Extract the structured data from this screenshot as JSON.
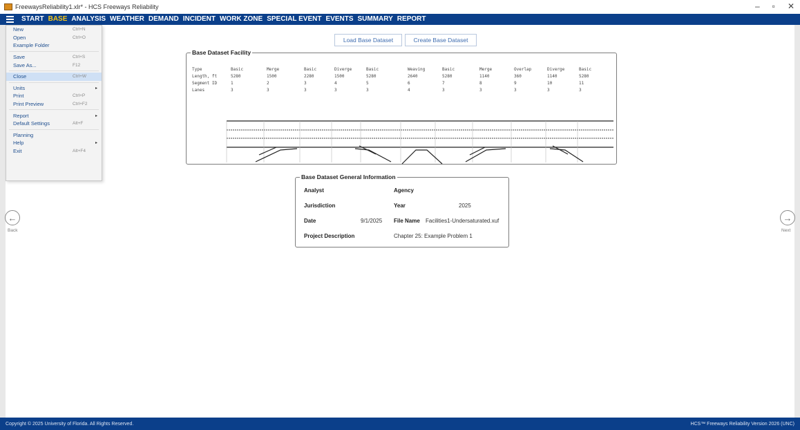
{
  "window": {
    "title": "FreewaysReliability1.xlr* - HCS Freeways Reliability",
    "controls": [
      "–",
      "▫",
      "✕"
    ]
  },
  "menu": {
    "tabs": [
      {
        "label": "START",
        "active": false
      },
      {
        "label": "BASE",
        "active": true
      },
      {
        "label": "ANALYSIS",
        "active": false
      },
      {
        "label": "WEATHER",
        "active": false
      },
      {
        "label": "DEMAND",
        "active": false
      },
      {
        "label": "INCIDENT",
        "active": false
      },
      {
        "label": "WORK ZONE",
        "active": false
      },
      {
        "label": "SPECIAL EVENT",
        "active": false
      },
      {
        "label": "EVENTS",
        "active": false
      },
      {
        "label": "SUMMARY",
        "active": false
      },
      {
        "label": "REPORT",
        "active": false
      }
    ],
    "active_color": "#f5c518",
    "bar_color": "#0b3f8a"
  },
  "file_menu": {
    "items": [
      {
        "label": "New",
        "shortcut": "Ctrl+N"
      },
      {
        "label": "Open",
        "shortcut": "Ctrl+O"
      },
      {
        "label": "Example Folder",
        "shortcut": ""
      },
      {
        "label": "Save",
        "shortcut": "Ctrl+S"
      },
      {
        "label": "Save As...",
        "shortcut": "F12"
      },
      {
        "label": "Close",
        "shortcut": "Ctrl+W"
      },
      {
        "label": "Units",
        "shortcut": "",
        "submenu": true
      },
      {
        "label": "Print",
        "shortcut": "Ctrl+P"
      },
      {
        "label": "Print Preview",
        "shortcut": "Ctrl+F2"
      },
      {
        "label": "Report",
        "shortcut": "",
        "submenu": true
      },
      {
        "label": "Default Settings",
        "shortcut": "Alt+F"
      },
      {
        "label": "Planning",
        "shortcut": ""
      },
      {
        "label": "Help",
        "shortcut": "",
        "submenu": true
      },
      {
        "label": "Exit",
        "shortcut": "Alt+F4"
      }
    ],
    "highlighted": "Close"
  },
  "buttons": {
    "load_base": "Load Base Dataset",
    "create_base": "Create Base Dataset"
  },
  "facility": {
    "title": "Base Dataset Facility",
    "row_labels": [
      "Type",
      "Length, ft",
      "Segment ID",
      "Lanes"
    ],
    "segments": [
      {
        "type": "Basic",
        "length": "5280",
        "id": "1",
        "lanes": "3"
      },
      {
        "type": "Merge",
        "length": "1500",
        "id": "2",
        "lanes": "3"
      },
      {
        "type": "Basic",
        "length": "2280",
        "id": "3",
        "lanes": "3"
      },
      {
        "type": "Diverge",
        "length": "1500",
        "id": "4",
        "lanes": "3"
      },
      {
        "type": "Basic",
        "length": "5280",
        "id": "5",
        "lanes": "3"
      },
      {
        "type": "Weaving",
        "length": "2640",
        "id": "6",
        "lanes": "4"
      },
      {
        "type": "Basic",
        "length": "5280",
        "id": "7",
        "lanes": "3"
      },
      {
        "type": "Merge",
        "length": "1140",
        "id": "8",
        "lanes": "3"
      },
      {
        "type": "Overlap",
        "length": "360",
        "id": "9",
        "lanes": "3"
      },
      {
        "type": "Diverge",
        "length": "1140",
        "id": "10",
        "lanes": "3"
      },
      {
        "type": "Basic",
        "length": "5280",
        "id": "11",
        "lanes": "3"
      }
    ]
  },
  "general_info": {
    "title": "Base Dataset General Information",
    "analyst_label": "Analyst",
    "analyst_value": "",
    "agency_label": "Agency",
    "agency_value": "",
    "jurisdiction_label": "Jurisdiction",
    "jurisdiction_value": "",
    "year_label": "Year",
    "year_value": "2025",
    "date_label": "Date",
    "date_value": "9/1/2025",
    "filename_label": "File Name",
    "filename_value": "Facilities1-Undersaturated.xuf",
    "desc_label": "Project Description",
    "desc_value": "Chapter 25: Example Problem 1"
  },
  "nav": {
    "back_label": "Back",
    "next_label": "Next"
  },
  "status": {
    "copyright": "Copyright © 2025 University of Florida. All Rights Reserved.",
    "version": "HCS™ Freeways Reliability Version 2026 (UNC)"
  }
}
